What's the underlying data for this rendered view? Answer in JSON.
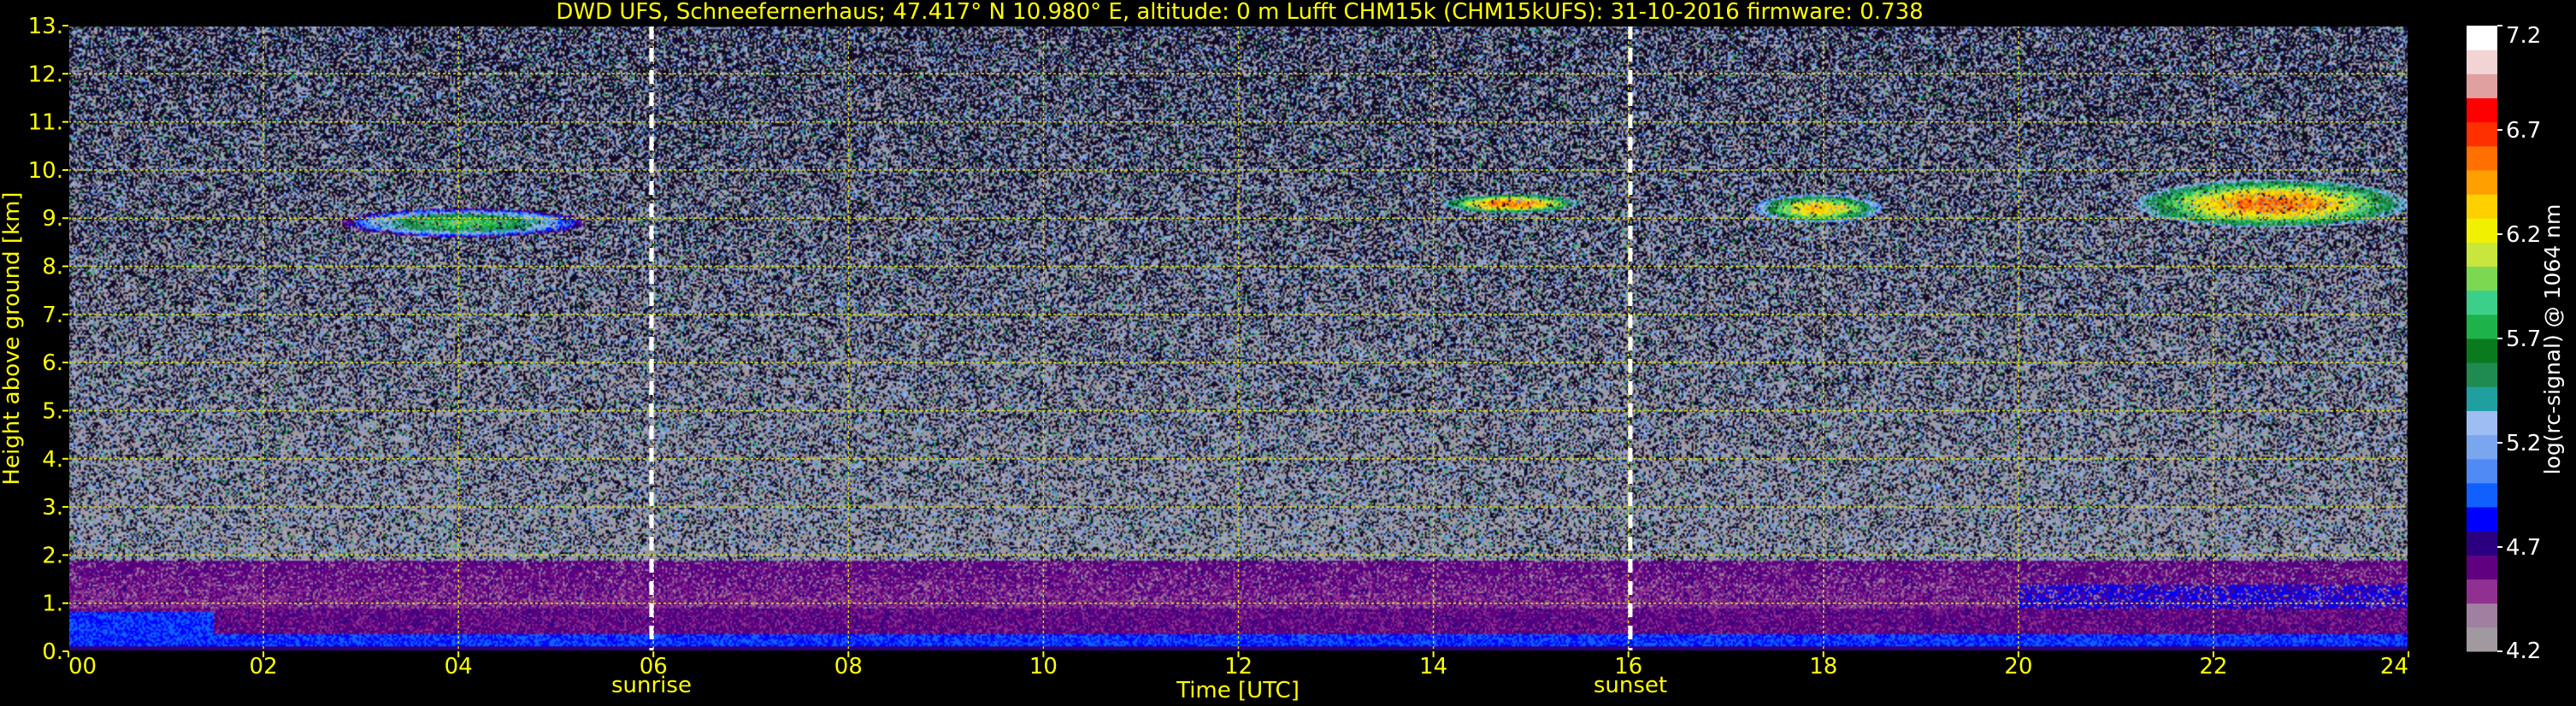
{
  "chart_data": {
    "type": "heatmap",
    "title": "DWD UFS, Schneefernerhaus; 47.417° N 10.980° E, altitude: 0 m    Lufft CHM15k (CHM15kUFS): 31-10-2016    firmware: 0.738",
    "xlabel": "Time [UTC]",
    "ylabel": "Height above ground [km]",
    "colorbar_label": "log(rc-signal) @ 1064 nm",
    "xlim": [
      0,
      24
    ],
    "ylim": [
      0,
      13
    ],
    "clim": [
      4.2,
      7.2
    ],
    "grid": true,
    "x_ticks": [
      {
        "value": 0,
        "label": "00"
      },
      {
        "value": 2,
        "label": "02"
      },
      {
        "value": 4,
        "label": "04"
      },
      {
        "value": 6,
        "label": "06"
      },
      {
        "value": 8,
        "label": "08"
      },
      {
        "value": 10,
        "label": "10"
      },
      {
        "value": 12,
        "label": "12"
      },
      {
        "value": 14,
        "label": "14"
      },
      {
        "value": 16,
        "label": "16"
      },
      {
        "value": 18,
        "label": "18"
      },
      {
        "value": 20,
        "label": "20"
      },
      {
        "value": 22,
        "label": "22"
      },
      {
        "value": 24,
        "label": "24"
      }
    ],
    "y_ticks": [
      {
        "value": 0,
        "label": "0."
      },
      {
        "value": 1,
        "label": "1."
      },
      {
        "value": 2,
        "label": "2."
      },
      {
        "value": 3,
        "label": "3."
      },
      {
        "value": 4,
        "label": "4."
      },
      {
        "value": 5,
        "label": "5."
      },
      {
        "value": 6,
        "label": "6."
      },
      {
        "value": 7,
        "label": "7."
      },
      {
        "value": 8,
        "label": "8."
      },
      {
        "value": 9,
        "label": "9."
      },
      {
        "value": 10,
        "label": "10."
      },
      {
        "value": 11,
        "label": "11."
      },
      {
        "value": 12,
        "label": "12."
      },
      {
        "value": 13,
        "label": "13."
      }
    ],
    "colorbar_ticks": [
      {
        "value": 4.2,
        "label": "4.2"
      },
      {
        "value": 4.7,
        "label": "4.7"
      },
      {
        "value": 5.2,
        "label": "5.2"
      },
      {
        "value": 5.7,
        "label": "5.7"
      },
      {
        "value": 6.2,
        "label": "6.2"
      },
      {
        "value": 6.7,
        "label": "6.7"
      },
      {
        "value": 7.2,
        "label": "7.2"
      }
    ],
    "colormap": [
      "#a09aa0",
      "#a080a0",
      "#903090",
      "#600080",
      "#2a0080",
      "#0000ff",
      "#1060ff",
      "#4f8af5",
      "#7aa6f0",
      "#9ebef3",
      "#1f9f9f",
      "#1e8c50",
      "#0a7a1e",
      "#1db24a",
      "#3ccf8a",
      "#7cd850",
      "#c8e63c",
      "#f0f000",
      "#ffd000",
      "#ffa000",
      "#ff7000",
      "#ff3000",
      "#ff0000",
      "#e0a0a0",
      "#f2d4d4",
      "#ffffff"
    ],
    "markers": [
      {
        "x": 5.98,
        "label": "sunrise"
      },
      {
        "x": 16.02,
        "label": "sunset"
      }
    ],
    "features": [
      {
        "name": "cloud",
        "x": [
          2.8,
          5.3
        ],
        "height_km": [
          8.6,
          9.2
        ],
        "level": 5.9
      },
      {
        "name": "cloud",
        "x": [
          14.1,
          15.5
        ],
        "height_km": [
          9.1,
          9.5
        ],
        "level": 6.6
      },
      {
        "name": "cloud",
        "x": [
          17.3,
          18.6
        ],
        "height_km": [
          8.9,
          9.5
        ],
        "level": 6.4
      },
      {
        "name": "cloud",
        "x": [
          21.2,
          24.0
        ],
        "height_km": [
          8.8,
          9.8
        ],
        "level": 6.6
      },
      {
        "name": "boundary-layer",
        "x": [
          0,
          24
        ],
        "height_km": [
          0,
          1.8
        ],
        "level": 4.6
      },
      {
        "name": "surface-return",
        "x": [
          0,
          24
        ],
        "height_km": [
          0.1,
          0.35
        ],
        "level": 4.7
      }
    ]
  }
}
